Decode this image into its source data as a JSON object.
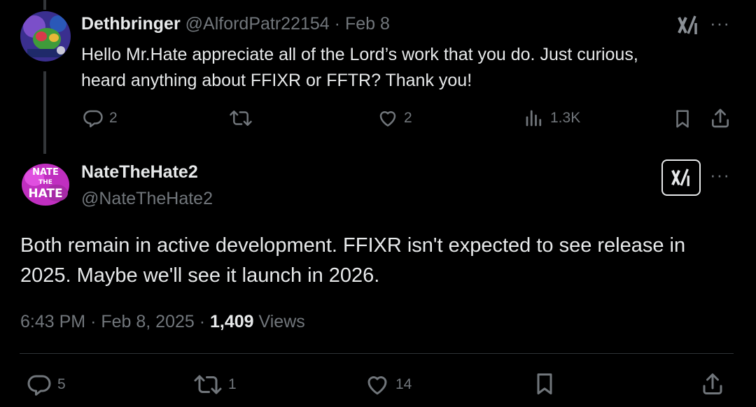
{
  "reply": {
    "display_name": "Dethbringer",
    "handle": "@AlfordPatr22154",
    "separator": "·",
    "date": "Feb 8",
    "text_line1": "Hello Mr.Hate appreciate all of the Lord’s work that you do. Just curious,",
    "text_line2": "heard anything about FFIXR or FFTR? Thank you!",
    "actions": {
      "replies": "2",
      "reposts": "",
      "likes": "2",
      "views": "1.3K"
    }
  },
  "main": {
    "display_name": "NateTheHate2",
    "handle": "@NateTheHate2",
    "avatar_text": "NATE THE HATE",
    "text_line1": "Both remain in active development. FFIXR isn't expected to see release in",
    "text_line2": "2025. Maybe we'll see it launch in 2026.",
    "time": "6:43 PM",
    "sep1": "·",
    "date": "Feb 8, 2025",
    "sep2": "·",
    "views_count": "1,409",
    "views_label": "Views",
    "actions": {
      "replies": "5",
      "reposts": "1",
      "likes": "14"
    }
  },
  "more_label": "···",
  "colors": {
    "background": "#000000",
    "text": "#e7e9ea",
    "muted": "#71767b",
    "thread_line": "#333639"
  },
  "icons": [
    "grok-icon",
    "more-icon",
    "reply-icon",
    "repost-icon",
    "like-icon",
    "views-icon",
    "bookmark-icon",
    "share-icon"
  ]
}
